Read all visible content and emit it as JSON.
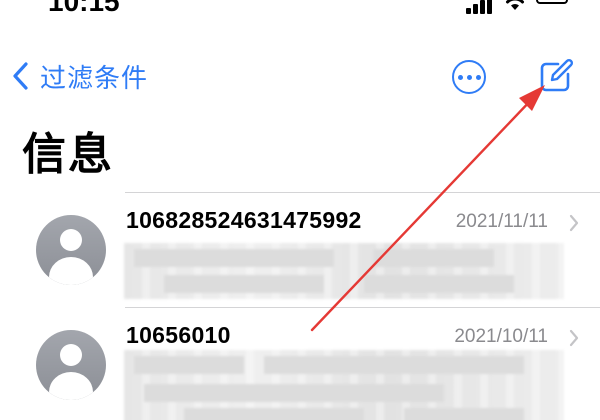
{
  "status_bar": {
    "time": "10:15"
  },
  "nav": {
    "back_label": "过滤条件",
    "accent_color": "#2f7cf6",
    "icons": [
      "chevron-left-icon",
      "ellipsis-circle-icon",
      "compose-icon"
    ]
  },
  "title": "信息",
  "conversations": [
    {
      "sender": "106828524631475992",
      "date": "2021/11/11",
      "preview": ""
    },
    {
      "sender": "10656010",
      "date": "2021/10/11",
      "preview": ""
    }
  ],
  "annotation": {
    "color": "#e53935",
    "points_to": "compose-button"
  }
}
